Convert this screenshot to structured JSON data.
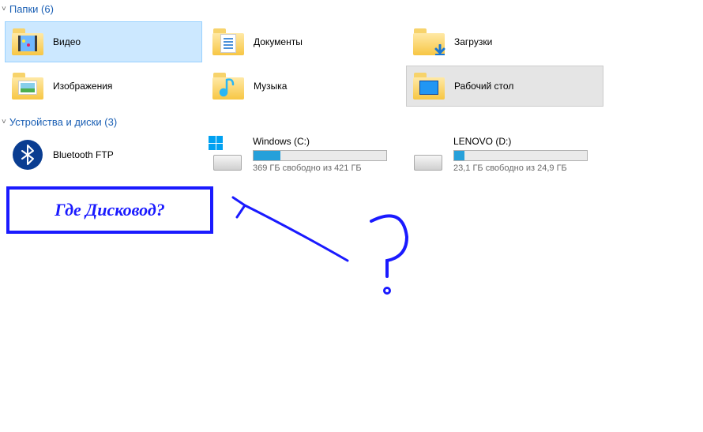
{
  "sections": {
    "folders": {
      "title": "Папки",
      "count": 6
    },
    "devices": {
      "title": "Устройства и диски",
      "count": 3
    }
  },
  "folders": [
    {
      "label": "Видео",
      "icon": "video",
      "state": "selected"
    },
    {
      "label": "Документы",
      "icon": "documents",
      "state": "normal"
    },
    {
      "label": "Загрузки",
      "icon": "downloads",
      "state": "normal"
    },
    {
      "label": "Изображения",
      "icon": "pictures",
      "state": "normal"
    },
    {
      "label": "Музыка",
      "icon": "music",
      "state": "normal"
    },
    {
      "label": "Рабочий стол",
      "icon": "desktop",
      "state": "highlight"
    }
  ],
  "devices": {
    "bluetooth": {
      "label": "Bluetooth FTP"
    },
    "drives": [
      {
        "title": "Windows (C:)",
        "fill_pct": 20,
        "sub": "369 ГБ свободно из 421 ГБ",
        "kind": "system"
      },
      {
        "title": "LENOVO (D:)",
        "fill_pct": 8,
        "sub": "23,1 ГБ свободно из 24,9 ГБ",
        "kind": "data"
      }
    ]
  },
  "annotation": {
    "text": "Где Дисковод?"
  }
}
